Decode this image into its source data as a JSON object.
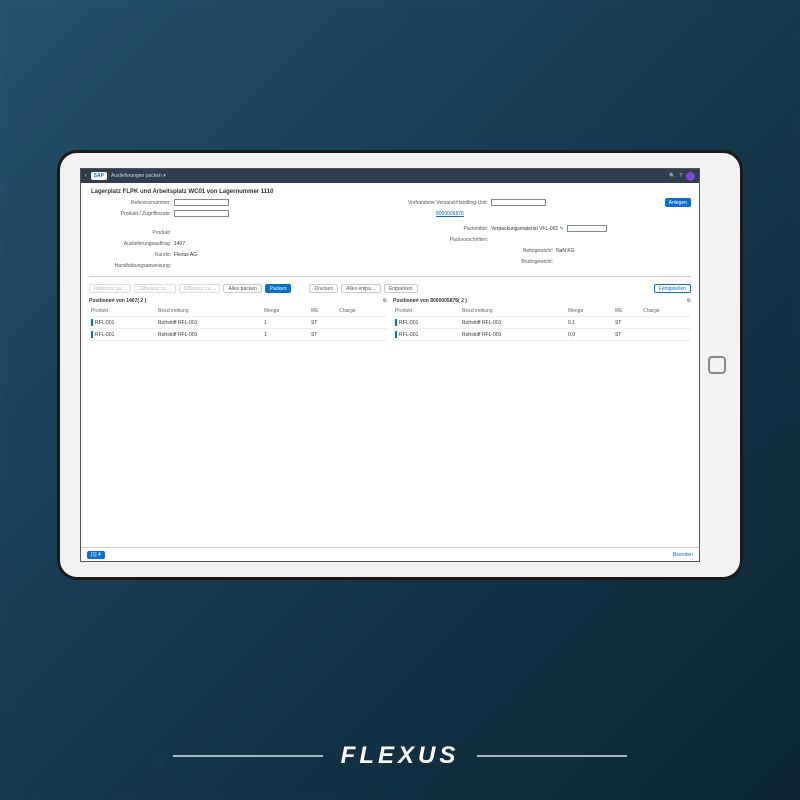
{
  "brand": {
    "footer_logo": "FLEXUS"
  },
  "topbar": {
    "logo_text": "SAP",
    "title": "Auslieferungen packen ▾",
    "icons": {
      "search": "🔍",
      "help": "?"
    }
  },
  "page": {
    "heading": "Lagerplatz FLPK und Arbeitsplatz WC01 von Lagernummer 1110",
    "left_form": {
      "ref_label": "Referenznummer:",
      "prod_label": "Produkt / Zugriffscode:",
      "produkt_label": "Produkt:",
      "auftrag_label": "Auslieferungsauftrag:",
      "auftrag_value": "1407",
      "kunde_label": "Kunde:",
      "kunde_value": "Flexus AG",
      "hand_label": "Handhabungsanweisung:"
    },
    "right_form": {
      "vhandling_label": "Vorhandene Versand-Handling-Unit:",
      "anlegen_btn": "Anlegen",
      "hu_number": "8000005876",
      "packmittel_label": "Packmittel:",
      "packmittel_value": "Verpackungsmaterial VFL-001",
      "packvor_label": "Packvorschriften:",
      "netto_label": "Nettogewicht:",
      "netto_value": "NaN KG",
      "brutto_label": "Bruttogewicht:"
    },
    "buttons": {
      "b1": "Referenz pa…",
      "b2": "Differenz zu…",
      "b3": "Differenz zu…",
      "alle_packen": "Alles packen",
      "packen": "Packen",
      "drucken": "Drucken",
      "alles_entpa": "Alles entpa…",
      "entpacken": "Entpacken",
      "fertigstellen": "Fertigstellen"
    },
    "table_left": {
      "title": "Positionen von 1407( 2 )",
      "cols": {
        "produkt": "Produkt",
        "beschreibung": "Beschreibung",
        "menge": "Menge",
        "me": "ME",
        "charge": "Charge"
      },
      "rows": [
        {
          "p": "RFL-001",
          "b": "Rohstoff RFL-001",
          "m": "1",
          "me": "ST",
          "c": ""
        },
        {
          "p": "RFL-001",
          "b": "Rohstoff RFL-001",
          "m": "1",
          "me": "ST",
          "c": ""
        }
      ]
    },
    "table_right": {
      "title": "Positionen von 8000005876( 2 )",
      "cols": {
        "produkt": "Produkt",
        "beschreibung": "Beschreibung",
        "menge": "Menge",
        "me": "ME",
        "charge": "Charge"
      },
      "rows": [
        {
          "p": "RFL-001",
          "b": "Rohstoff RFL-001",
          "m": "0,1",
          "me": "ST",
          "c": ""
        },
        {
          "p": "RFL-001",
          "b": "Rohstoff RFL-001",
          "m": "0,9",
          "me": "ST",
          "c": ""
        }
      ]
    },
    "footer": {
      "badge": "[1] 4",
      "beenden": "Beenden"
    }
  }
}
